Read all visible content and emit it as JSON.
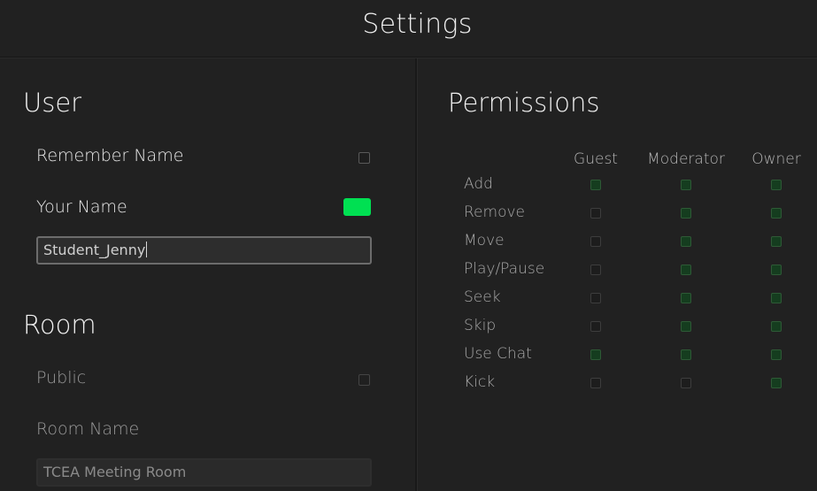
{
  "header": {
    "title": "Settings"
  },
  "user": {
    "heading": "User",
    "remember_name_label": "Remember Name",
    "remember_name_checked": false,
    "your_name_label": "Your Name",
    "name_color": "#00e052",
    "name_value": "Student_Jenny"
  },
  "room": {
    "heading": "Room",
    "public_label": "Public",
    "public_checked": false,
    "room_name_label": "Room Name",
    "room_name_value": "TCEA Meeting Room"
  },
  "permissions": {
    "heading": "Permissions",
    "columns": [
      "Guest",
      "Moderator",
      "Owner"
    ],
    "rows": [
      {
        "label": "Add",
        "values": [
          true,
          true,
          true
        ]
      },
      {
        "label": "Remove",
        "values": [
          false,
          true,
          true
        ]
      },
      {
        "label": "Move",
        "values": [
          false,
          true,
          true
        ]
      },
      {
        "label": "Play/Pause",
        "values": [
          false,
          true,
          true
        ]
      },
      {
        "label": "Seek",
        "values": [
          false,
          true,
          true
        ]
      },
      {
        "label": "Skip",
        "values": [
          false,
          true,
          true
        ]
      },
      {
        "label": "Use Chat",
        "values": [
          true,
          true,
          true
        ]
      },
      {
        "label": "Kick",
        "values": [
          false,
          false,
          true
        ]
      }
    ]
  }
}
